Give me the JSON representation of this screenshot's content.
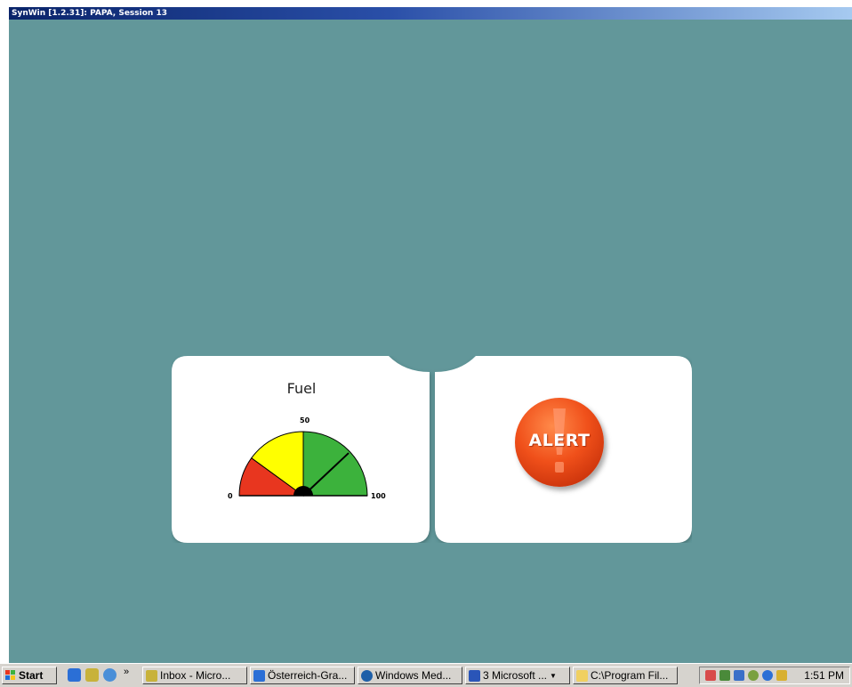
{
  "window": {
    "title": "SynWin [1.2.31]: PAPA, Session 13"
  },
  "gauge": {
    "title": "Fuel",
    "min_label": "0",
    "mid_label": "50",
    "max_label": "100",
    "value": 76,
    "zones": [
      {
        "from": 0,
        "to": 20,
        "color": "#e8361f"
      },
      {
        "from": 20,
        "to": 50,
        "color": "#ffff00"
      },
      {
        "from": 50,
        "to": 100,
        "color": "#3cb23c"
      }
    ]
  },
  "alert": {
    "label": "ALERT",
    "color": "#e8501a"
  },
  "colors": {
    "background": "#62979a",
    "panel": "#ffffff"
  },
  "taskbar": {
    "start_label": "Start",
    "quick_launch": [
      "ie-icon",
      "app-icon",
      "outlook-icon"
    ],
    "overflow_label": "»",
    "tasks": [
      {
        "label": "Inbox - Micro...",
        "icon": "outlook-icon"
      },
      {
        "label": "Österreich-Gra...",
        "icon": "ie-icon"
      },
      {
        "label": "Windows Med...",
        "icon": "media-player-icon"
      },
      {
        "label": "3 Microsoft ...",
        "icon": "word-icon"
      },
      {
        "label": "C:\\Program Fil...",
        "icon": "folder-icon"
      }
    ],
    "clock": "1:51 PM"
  }
}
